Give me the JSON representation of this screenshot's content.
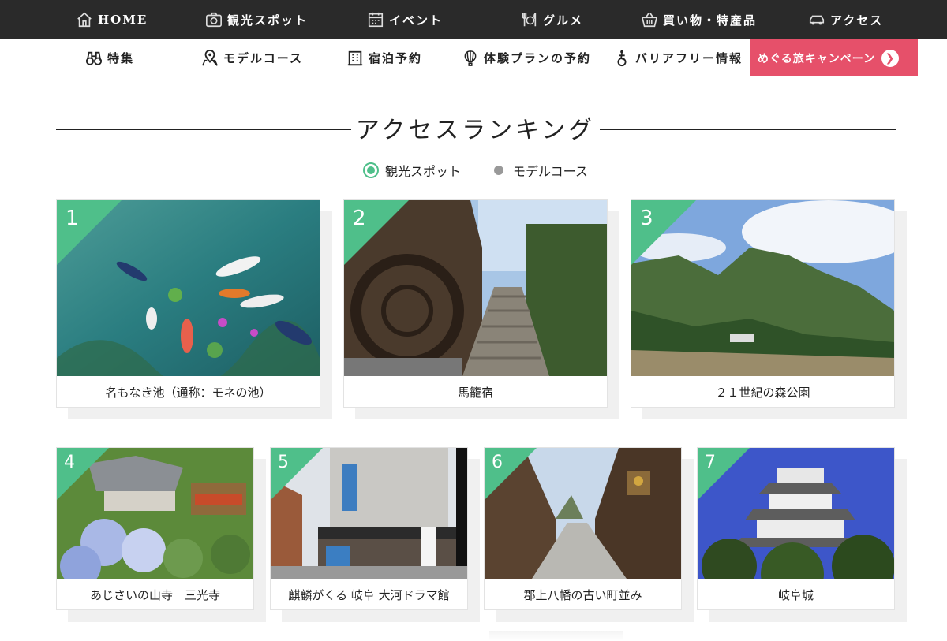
{
  "top_nav": [
    {
      "label": "HOME",
      "icon": "house-icon"
    },
    {
      "label": "観光スポット",
      "icon": "camera-icon"
    },
    {
      "label": "イベント",
      "icon": "calendar-icon"
    },
    {
      "label": "グルメ",
      "icon": "cutlery-icon"
    },
    {
      "label": "買い物・特産品",
      "icon": "basket-icon"
    },
    {
      "label": "アクセス",
      "icon": "car-icon"
    }
  ],
  "sub_nav": [
    {
      "label": "特集",
      "icon": "binoculars-icon"
    },
    {
      "label": "モデルコース",
      "icon": "map-pin-icon"
    },
    {
      "label": "宿泊予約",
      "icon": "building-icon"
    },
    {
      "label": "体験プランの予約",
      "icon": "balloon-icon"
    },
    {
      "label": "バリアフリー情報",
      "icon": "wheelchair-icon"
    }
  ],
  "campaign": {
    "label": "めぐる旅キャンペーン",
    "icon": "arrow-right-icon",
    "color": "#e6506a"
  },
  "section": {
    "title": "アクセスランキング"
  },
  "toggle": {
    "selected": "観光スポット",
    "other": "モデルコース",
    "accent": "#4fbf8a"
  },
  "ranking": [
    {
      "rank": "1",
      "name": "名もなき池（通称：モネの池）"
    },
    {
      "rank": "2",
      "name": "馬籠宿"
    },
    {
      "rank": "3",
      "name": "２１世紀の森公園"
    },
    {
      "rank": "4",
      "name": "あじさいの山寺　三光寺"
    },
    {
      "rank": "5",
      "name": "麒麟がくる 岐阜 大河ドラマ館"
    },
    {
      "rank": "6",
      "name": "郡上八幡の古い町並み"
    },
    {
      "rank": "7",
      "name": "岐阜城"
    }
  ]
}
